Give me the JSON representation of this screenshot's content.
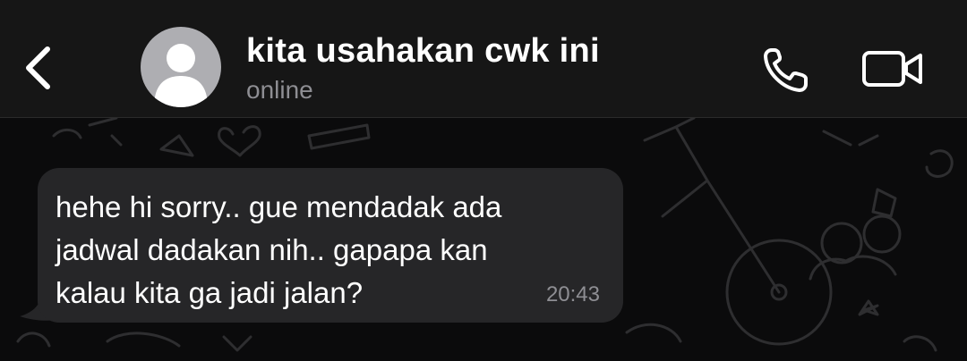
{
  "header": {
    "contact_name": "kita usahakan cwk ini",
    "status": "online"
  },
  "icons": {
    "back": "chevron-left-icon",
    "avatar": "person-icon",
    "call": "phone-icon",
    "video": "video-camera-icon"
  },
  "messages": [
    {
      "direction": "incoming",
      "text": "hehe hi sorry.. gue mendadak ada\njadwal dadakan nih.. gapapa kan\nkalau kita ga jadi jalan?",
      "time": "20:43"
    }
  ],
  "colors": {
    "header_bg": "#161616",
    "chat_bg": "#0b0b0c",
    "bubble_bg": "#262628",
    "secondary_text": "#8e8e93"
  }
}
